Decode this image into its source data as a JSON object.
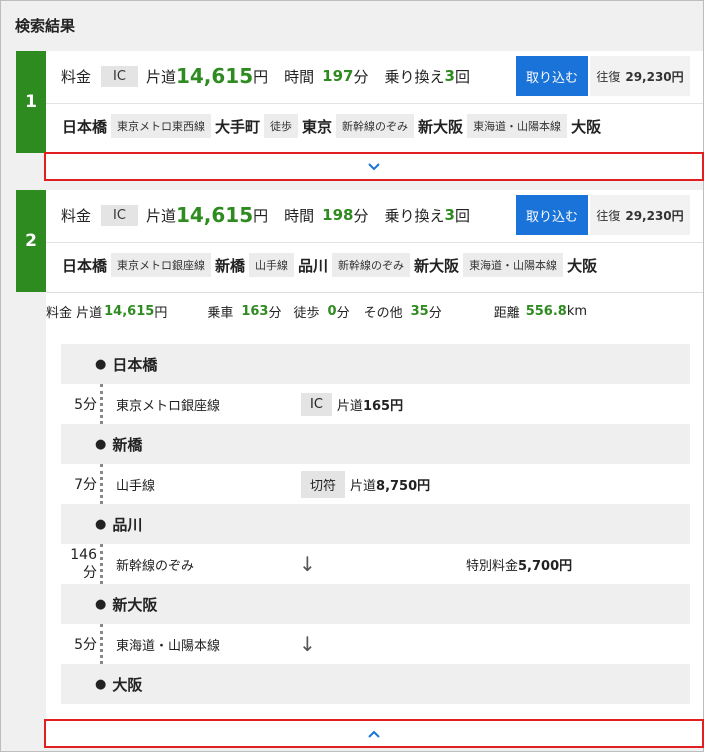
{
  "page_title": "検索結果",
  "common": {
    "fare_label": "料金",
    "ic_label": "IC",
    "oneway_label": "片道",
    "oneway_yen": "円",
    "time_label": "時間",
    "minute_unit": "分",
    "transfer_label": "乗り換え",
    "transfer_unit": "回",
    "import_label": "取り込む",
    "roundtrip_label": "往復"
  },
  "routes": [
    {
      "number": "1",
      "fare": "14,615",
      "time": "197",
      "transfers": "3",
      "roundtrip": "29,230円",
      "path": [
        "日本橋",
        "東京メトロ東西線",
        "大手町",
        "徒歩",
        "東京",
        "新幹線のぞみ",
        "新大阪",
        "東海道・山陽本線",
        "大阪"
      ]
    },
    {
      "number": "2",
      "fare": "14,615",
      "time": "198",
      "transfers": "3",
      "roundtrip": "29,230円",
      "path": [
        "日本橋",
        "東京メトロ銀座線",
        "新橋",
        "山手線",
        "品川",
        "新幹線のぞみ",
        "新大阪",
        "東海道・山陽本線",
        "大阪"
      ]
    }
  ],
  "detail": {
    "fare_label": "料金 片道",
    "fare_value": "14,615",
    "fare_unit": "円",
    "ride_label": "乗車",
    "ride_value": "163",
    "walk_label": "徒歩",
    "walk_value": "0",
    "other_label": "その他",
    "other_value": "35",
    "minute_unit": "分",
    "distance_label": "距離",
    "distance_value": "556.8",
    "distance_unit": "km",
    "stops": [
      "日本橋",
      "新橋",
      "品川",
      "新大阪",
      "大阪"
    ],
    "segments": [
      {
        "dur_a": "5分",
        "dur_b": "",
        "line": "東京メトロ銀座線",
        "ticket_tag": "IC",
        "fare_label": "片道",
        "fare_value": "165円",
        "special": ""
      },
      {
        "dur_a": "7分",
        "dur_b": "",
        "line": "山手線",
        "ticket_tag": "切符",
        "fare_label": "片道",
        "fare_value": "8,750円",
        "special": ""
      },
      {
        "dur_a": "146",
        "dur_b": "分",
        "line": "新幹線のぞみ",
        "ticket_tag": "",
        "fare_label": "",
        "fare_value": "",
        "special_label": "特別料金",
        "special_value": "5,700円"
      },
      {
        "dur_a": "5分",
        "dur_b": "",
        "line": "東海道・山陽本線",
        "ticket_tag": "",
        "fare_label": "",
        "fare_value": "",
        "special": ""
      }
    ]
  },
  "colors": {
    "accent_green": "#2e8b1f",
    "button_blue": "#1a73d9",
    "highlight_red": "#e02020"
  },
  "icons": {
    "expand": "chevron-down-icon",
    "collapse": "chevron-up-icon",
    "arrow": "arrow-down-icon"
  }
}
